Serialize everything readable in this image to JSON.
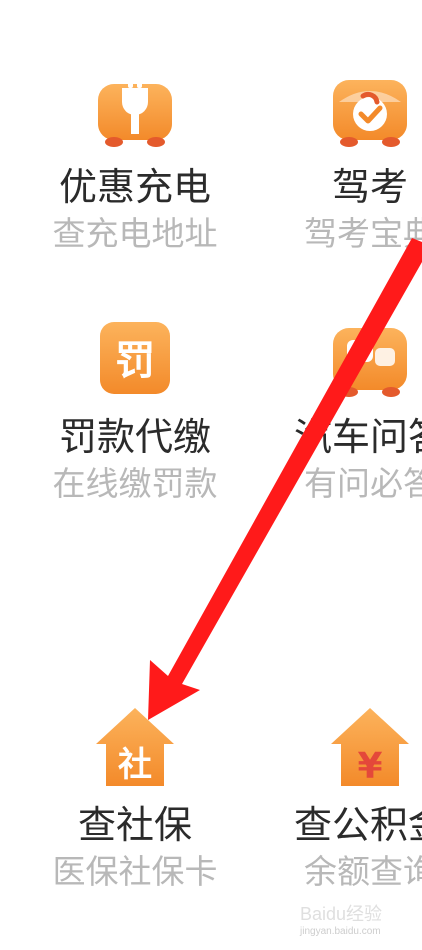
{
  "services": [
    {
      "title": "优惠充电",
      "subtitle": "查充电地址",
      "icon": "charging-plug-icon"
    },
    {
      "title": "驾考",
      "subtitle": "驾考宝典",
      "icon": "driving-test-icon"
    },
    {
      "title": "罚款代缴",
      "subtitle": "在线缴罚款",
      "icon": "fine-payment-icon"
    },
    {
      "title": "汽车问答",
      "subtitle": "有问必答",
      "icon": "car-qa-icon"
    },
    {
      "title": "查社保",
      "subtitle": "医保社保卡",
      "icon": "social-security-house-icon",
      "icon_glyph": "社"
    },
    {
      "title": "查公积金",
      "subtitle": "余额查询",
      "icon": "housing-fund-house-icon",
      "icon_glyph": "¥"
    }
  ],
  "fine_icon_glyph": "罚",
  "annotation": {
    "type": "red-arrow",
    "color": "#ff1a1a",
    "points_to": "查社保"
  },
  "watermark": {
    "text": "Baidu经验",
    "url": "jingyan.baidu.com"
  },
  "colors": {
    "accent": "#f7932e",
    "accent_light": "#fbb35a",
    "title_text": "#2b2b2b",
    "subtitle_text": "#b8b8b8"
  }
}
